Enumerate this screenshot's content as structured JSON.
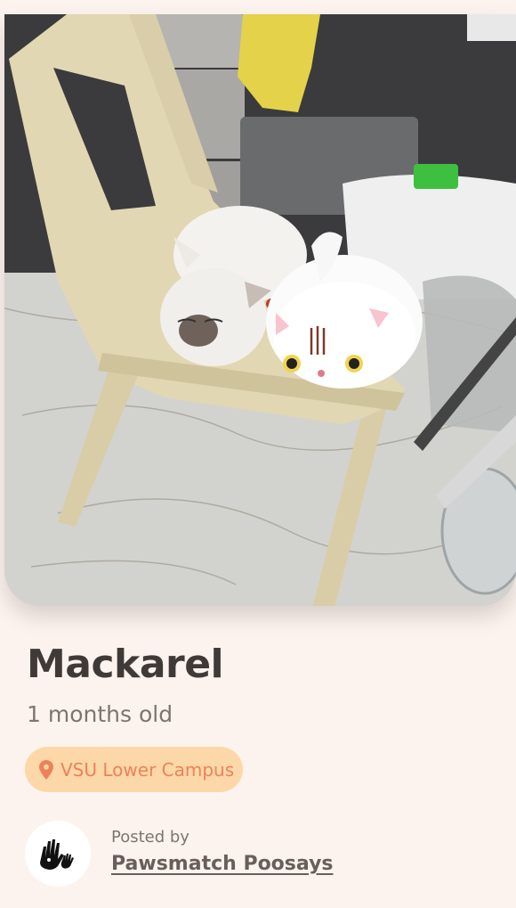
{
  "pet": {
    "name": "Mackarel",
    "age": "1 months old",
    "location": "VSU Lower Campus"
  },
  "poster": {
    "posted_by_label": "Posted by",
    "name": "Pawsmatch Poosays"
  },
  "icons": {
    "location": "map-pin-icon",
    "avatar": "paw-hands-logo"
  },
  "colors": {
    "background": "#fdf3ee",
    "pill_background": "#fcd8a9",
    "pill_text": "#f0805a",
    "title_text": "#3f3a38"
  }
}
